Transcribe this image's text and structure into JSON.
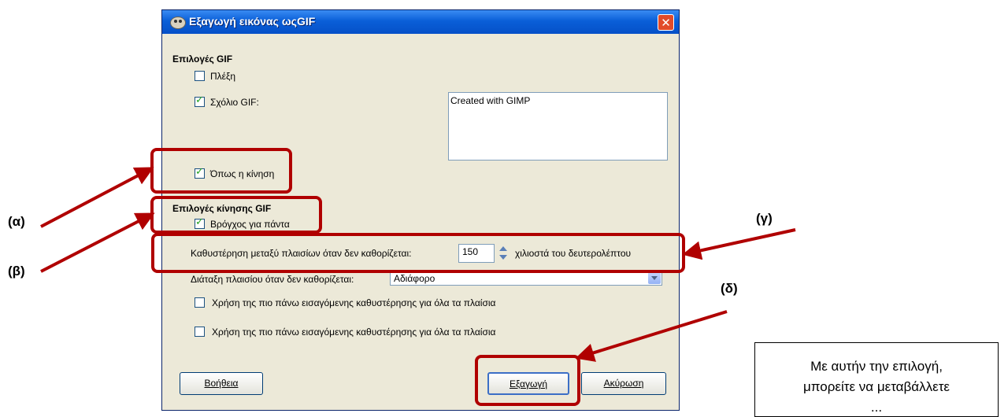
{
  "dialog": {
    "title": "Εξαγωγή εικόνας ωςGIF",
    "close_label": "✕",
    "gif_options_heading": "Επιλογές GIF",
    "interlace_label": "Πλέξη",
    "interlace_checked": false,
    "gif_comment_label": "Σχόλιο GIF:",
    "gif_comment_checked": true,
    "gif_comment_value": "Created with GIMP",
    "as_animation_label": "Όπως η κίνηση",
    "as_animation_checked": true,
    "animation_options_heading": "Επιλογές κίνησης GIF",
    "loop_forever_label": "Βρόγχος για πάντα",
    "loop_forever_checked": true,
    "delay_label": "Καθυστέρηση μεταξύ πλαισίων όταν δεν καθορίζεται:",
    "delay_value": "150",
    "delay_unit": "χιλιοστά του δευτερολέπτου",
    "disposal_label": "Διάταξη πλαισίου όταν δεν καθορίζεται:",
    "disposal_value": "Αδιάφορο",
    "use_delay_label_1": "Χρήση της πιο πάνω εισαγόμενης καθυστέρησης για όλα τα πλαίσια",
    "use_delay_checked_1": false,
    "use_delay_label_2": "Χρήση της πιο πάνω εισαγόμενης καθυστέρησης για όλα τα πλαίσια",
    "use_delay_checked_2": false,
    "help_button": "Βοήθεια",
    "export_button": "Εξαγωγή",
    "cancel_button": "Ακύρωση"
  },
  "annotations": {
    "label_a": "(α)",
    "label_b": "(β)",
    "label_c": "(γ)",
    "label_d": "(δ)",
    "highlight_color": "#B00000"
  },
  "note": {
    "line1": "Με αυτήν την επιλογή,",
    "line2": "μπορείτε να μεταβάλλετε",
    "line3": "..."
  },
  "icons": {
    "title_icon": "gimp-icon",
    "close_icon": "close-icon",
    "spin_icon": "spinner-arrows-icon",
    "dropdown_icon": "chevron-down-icon"
  }
}
